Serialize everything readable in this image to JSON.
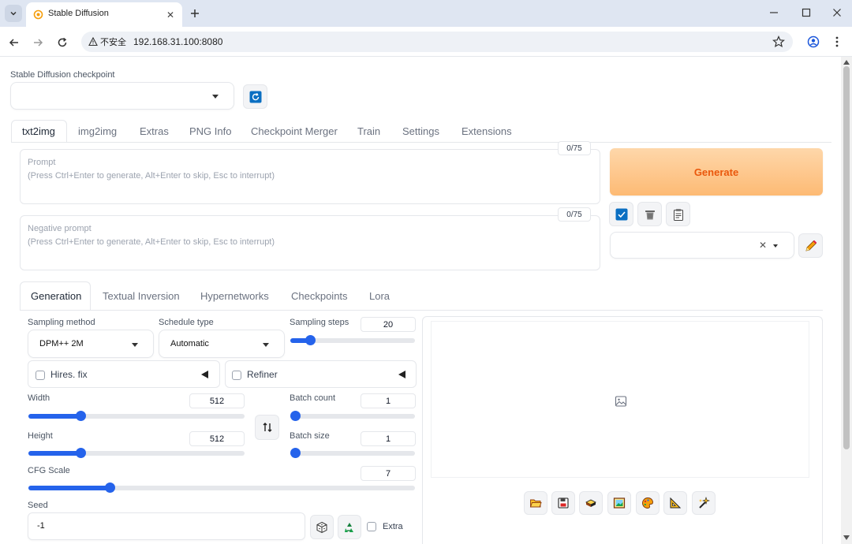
{
  "browser": {
    "tab_title": "Stable Diffusion",
    "security_label": "不安全",
    "url": "192.168.31.100:8080"
  },
  "checkpoint": {
    "label": "Stable Diffusion checkpoint",
    "value": ""
  },
  "main_tabs": [
    "txt2img",
    "img2img",
    "Extras",
    "PNG Info",
    "Checkpoint Merger",
    "Train",
    "Settings",
    "Extensions"
  ],
  "prompt": {
    "title": "Prompt",
    "placeholder": "(Press Ctrl+Enter to generate, Alt+Enter to skip, Esc to interrupt)",
    "counter": "0/75"
  },
  "negative_prompt": {
    "title": "Negative prompt",
    "placeholder": "(Press Ctrl+Enter to generate, Alt+Enter to skip, Esc to interrupt)",
    "counter": "0/75"
  },
  "generate_label": "Generate",
  "sub_tabs": [
    "Generation",
    "Textual Inversion",
    "Hypernetworks",
    "Checkpoints",
    "Lora"
  ],
  "sampling_method": {
    "label": "Sampling method",
    "value": "DPM++ 2M"
  },
  "schedule_type": {
    "label": "Schedule type",
    "value": "Automatic"
  },
  "sampling_steps": {
    "label": "Sampling steps",
    "value": "20",
    "fraction": 0.16
  },
  "hires_fix": {
    "label": "Hires. fix",
    "checked": false
  },
  "refiner": {
    "label": "Refiner",
    "checked": false
  },
  "width": {
    "label": "Width",
    "value": "512",
    "fraction": 0.24
  },
  "height": {
    "label": "Height",
    "value": "512",
    "fraction": 0.24
  },
  "batch_count": {
    "label": "Batch count",
    "value": "1",
    "fraction": 0.0
  },
  "batch_size": {
    "label": "Batch size",
    "value": "1",
    "fraction": 0.0
  },
  "cfg_scale": {
    "label": "CFG Scale",
    "value": "7",
    "fraction": 0.21
  },
  "seed": {
    "label": "Seed",
    "value": "-1"
  },
  "extra_label": "Extra",
  "colors": {
    "accent": "#2563eb",
    "generate_text": "#ea580c",
    "generate_bg": "#fdba74"
  },
  "icons": {
    "refresh": "refresh-icon",
    "checkbox": "checkbox-icon",
    "trash": "trash-icon",
    "clipboard": "clipboard-icon",
    "pencil": "pencil-icon",
    "swap": "swap-icon",
    "dice": "dice-icon",
    "recycle": "recycle-icon",
    "image": "image-placeholder-icon",
    "output_buttons": [
      "folder-icon",
      "save-icon",
      "zip-icon",
      "send-to-img2img-icon",
      "send-to-inpaint-icon",
      "send-to-extras-icon",
      "sparkle-icon"
    ]
  }
}
